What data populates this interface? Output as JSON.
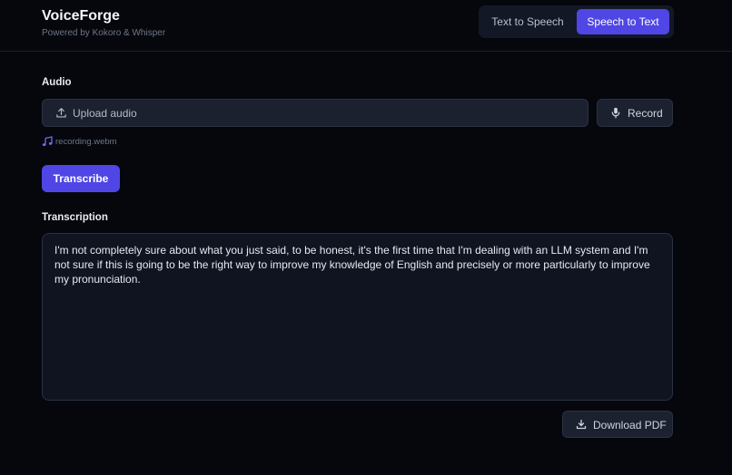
{
  "app": {
    "title": "VoiceForge",
    "subtitle": "Powered by Kokoro & Whisper"
  },
  "mode_toggle": {
    "tabs": [
      {
        "label": "Text to Speech",
        "active": false
      },
      {
        "label": "Speech to Text",
        "active": true
      }
    ]
  },
  "audio": {
    "label": "Audio",
    "upload_label": "Upload audio",
    "record_label": "Record",
    "file_name": "recording.webm"
  },
  "actions": {
    "transcribe_label": "Transcribe",
    "download_label": "Download PDF"
  },
  "transcription": {
    "label": "Transcription",
    "text": "I'm not completely sure about what you just said, to be honest, it's the first time that I'm dealing with an LLM system and I'm not sure if this is going to be the right way to improve my knowledge of English and precisely or more particularly to improve my pronunciation."
  },
  "icons": {
    "upload": "upload-icon",
    "record": "mic-icon",
    "file": "music-note-icon",
    "download": "download-icon"
  },
  "colors": {
    "accent": "#4f46e5",
    "background": "#05070d",
    "panel": "#1b212e",
    "file_icon": "#6b6ff0"
  }
}
